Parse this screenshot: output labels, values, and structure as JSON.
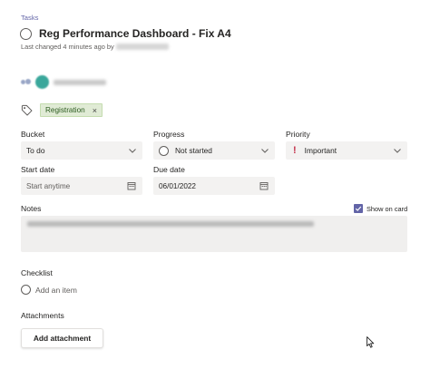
{
  "breadcrumb": "Tasks",
  "task": {
    "title": "Reg Performance Dashboard - Fix A4",
    "last_changed": "Last changed 4 minutes ago by"
  },
  "label": {
    "name": "Registration",
    "remove_glyph": "×"
  },
  "fields": {
    "bucket": {
      "label": "Bucket",
      "value": "To do"
    },
    "progress": {
      "label": "Progress",
      "value": "Not started"
    },
    "priority": {
      "label": "Priority",
      "value": "Important",
      "mark": "!"
    },
    "start_date": {
      "label": "Start date",
      "placeholder": "Start anytime"
    },
    "due_date": {
      "label": "Due date",
      "value": "06/01/2022"
    }
  },
  "notes": {
    "label": "Notes",
    "show_on_card": {
      "label": "Show on card",
      "checked": true
    }
  },
  "checklist": {
    "label": "Checklist",
    "add_item": "Add an item"
  },
  "attachments": {
    "label": "Attachments",
    "button": "Add attachment"
  },
  "colors": {
    "accent": "#6264a7",
    "label_chip_bg": "#e0ebd5",
    "priority_important": "#c4314b",
    "field_bg": "#f3f2f1"
  },
  "icons": {
    "task_status": "circle-icon",
    "label": "tag-icon",
    "dropdown": "chevron-down-icon",
    "calendar": "calendar-icon",
    "assign": "assign-people-icon",
    "cursor": "mouse-pointer-icon"
  }
}
